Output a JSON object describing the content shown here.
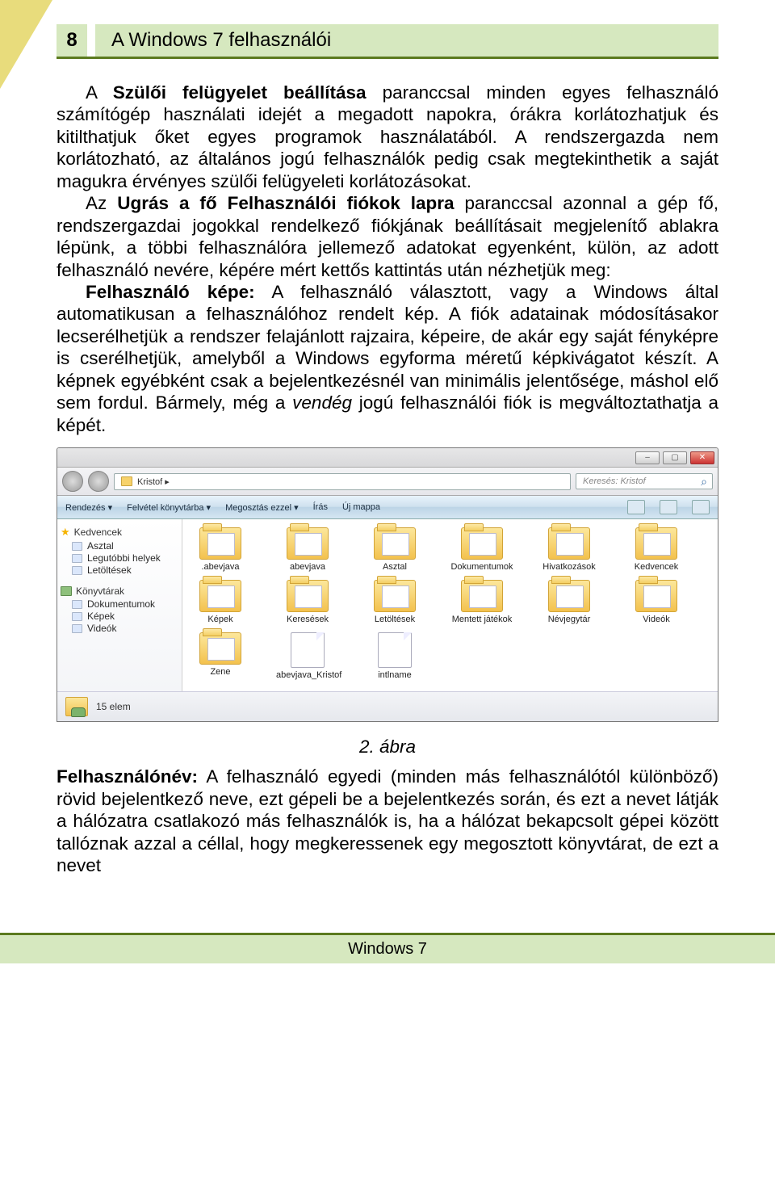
{
  "page_number": "8",
  "header_title": "A Windows 7 felhasználói",
  "paragraphs": {
    "p1_a": "A ",
    "p1_bold": "Szülői felügyelet beállítása",
    "p1_b": " paranccsal minden egyes felhasználó számítógép használati idejét a megadott napokra, órákra korlátozhatjuk és kitilthatjuk őket egyes programok használatából. A rendszergazda nem korlátozható, az általános jogú felhasználók pedig csak megtekinthetik a saját magukra érvényes szülői felügyeleti korlátozásokat.",
    "p2_a": "Az ",
    "p2_bold": "Ugrás a fő Felhasználói fiókok lapra",
    "p2_b": " paranccsal azonnal a gép fő, rendszergazdai jogokkal rendelkező fiókjának beállításait megjelenítő ablakra lépünk, a többi felhasználóra jellemező adatokat egyenként, külön, az adott felhasználó nevére, képére mért kettős kattintás után nézhetjük meg:",
    "p3_bold": "Felhasználó képe:",
    "p3_a": " A felhasználó választott, vagy a Windows által automatikusan a felhasználóhoz rendelt kép. A fiók adatainak módosításakor lecserélhetjük a rendszer felajánlott rajzaira, képeire, de akár egy saját fényképre is cserélhetjük, amelyből a Windows egyforma méretű képkivágatot készít. A képnek egyébként csak a bejelentkezésnél van minimális jelentősége, máshol elő sem fordul. Bármely, még a ",
    "p3_italic": "vendég",
    "p3_b": " jogú felhasználói fiók is megváltoztathatja a képét.",
    "p4_bold": "Felhasználónév:",
    "p4_a": " A felhasználó egyedi (minden más felhasználótól különböző) rövid bejelentkező neve, ezt gépeli be a bejelentkezés során, és ezt a nevet látják a hálózatra csatlakozó más felhasználók is, ha a hálózat bekapcsolt gépei között tallóznak azzal a céllal, hogy megkeressenek egy megosztott könyvtárat, de ezt a nevet"
  },
  "figure_caption": "2. ábra",
  "footer": "Windows 7",
  "explorer": {
    "breadcrumb": "Kristof  ▸",
    "search_placeholder": "Keresés: Kristof",
    "toolbar": {
      "rendezes": "Rendezés ▾",
      "felvetel": "Felvétel könyvtárba ▾",
      "megosztas": "Megosztás ezzel ▾",
      "iras": "Írás",
      "ujmappa": "Új mappa"
    },
    "sidebar": {
      "kedvencek": "Kedvencek",
      "asztal": "Asztal",
      "legutobbi": "Legutóbbi helyek",
      "letoltesek": "Letöltések",
      "konyvtarak": "Könyvtárak",
      "dokumentumok": "Dokumentumok",
      "kepek": "Képek",
      "videok": "Videók"
    },
    "icons": [
      ".abevjava",
      "abevjava",
      "Asztal",
      "Dokumentumok",
      "Hivatkozások",
      "Kedvencek",
      "Képek",
      "Keresések",
      "Letöltések",
      "Mentett játékok",
      "Névjegytár",
      "Videók",
      "Zene",
      "abevjava_Kristof",
      "intlname"
    ],
    "status": "15 elem"
  }
}
